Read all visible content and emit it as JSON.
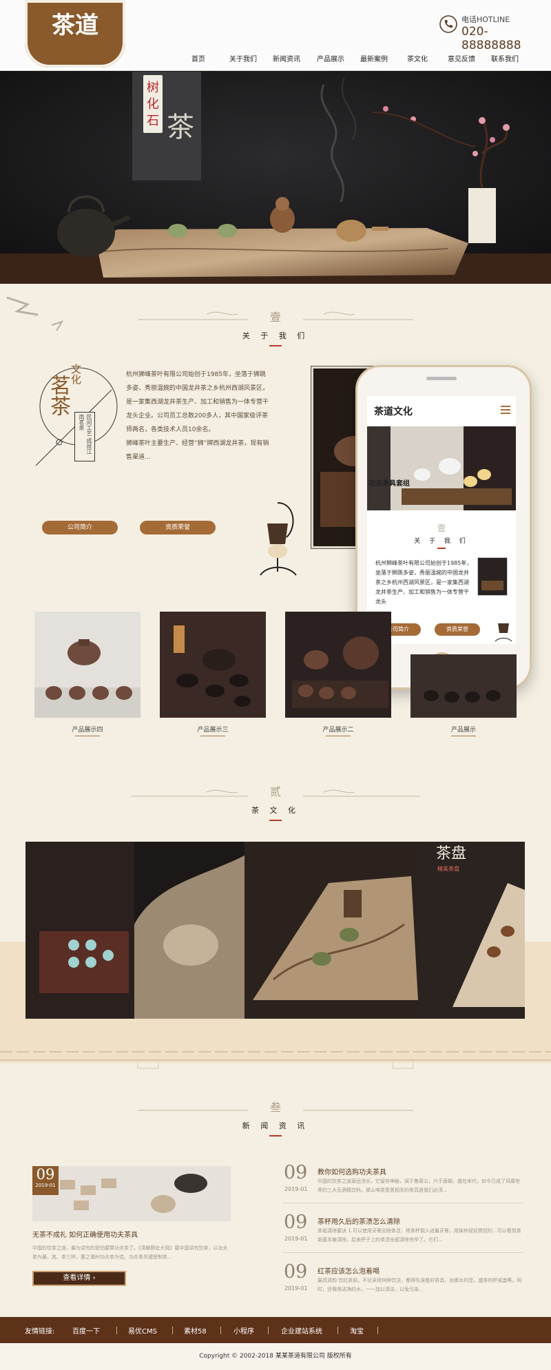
{
  "header": {
    "logo": "茶道",
    "hotline_label": "电话HOTLINE",
    "hotline_number": "020-88888888"
  },
  "nav": [
    "首页",
    "关于我们",
    "新闻资讯",
    "产品展示",
    "最新案例",
    "茶文化",
    "意见反馈",
    "联系我们"
  ],
  "banner": {
    "sign_text": [
      "树",
      "化",
      "石"
    ],
    "calligraphy": "茶"
  },
  "about": {
    "number": "壹",
    "title": "关 于 我 们",
    "badge_small": "文化",
    "badge_large": "茗茶",
    "badge_vertical": [
      "民间工艺",
      "成就江南茗茶"
    ],
    "para1": "杭州狮峰茶叶有限公司始创于1985年，坐落于狮跳多姿、秀丽温婉的中国龙井茶之乡杭州西湖风景区，是一家集西湖龙井茶生产、加工和销售为一体专营干龙头企业。公司员工总数200多人，其中国家级评茶师两名，各类技术人员10余名。",
    "para2": "狮峰茶叶主要生产、经营“狮”牌西湖龙井茶，现有销售渠道...",
    "btn_intro": "公司简介",
    "btn_honor": "资质荣誉"
  },
  "phone": {
    "brand": "茶道文化",
    "hero_text": "功夫茶具套组",
    "number": "壹",
    "title": "关 于 我 们",
    "text": "杭州狮峰茶叶有限公司始创于1985年，坐落于狮跳多姿，秀丽温婉的中国龙井茶之乡杭州西湖风景区，是一家集西湖龙井茶生产、加工和销售为一体专营干龙头",
    "btn_intro": "公司简介",
    "btn_honor": "资质荣誉"
  },
  "products": [
    "产品展示四",
    "产品展示三",
    "产品展示二",
    "产品展示"
  ],
  "culture": {
    "number": "贰",
    "title": "茶 文 化",
    "tea_tray_label": "茶盘",
    "tea_tray_sub": "精美茶盘"
  },
  "news": {
    "number": "叁",
    "title": "新 闻 资 讯",
    "featured": {
      "day": "09",
      "ym": "2019-01",
      "title": "无茶不成礼 如何正确使用功夫茶具",
      "desc": "中国的饮茶之道，最为讲究的恐怕要算功夫茶了。《清朝野史大观》载中国讲究饮茶，以功夫茶为最，其、茶三样，惠之潮州功夫茶为佳。功夫茶关键是制茶...",
      "more": "查看详情"
    },
    "items": [
      {
        "day": "09",
        "ym": "2019-01",
        "title": "教你如何选购功夫茶具",
        "desc": "中国的饮茶之道源远流长，它留存神秘，闻于鲁周公，兴于唐朝，盛在宋代，如今已成了风靡世界的三大无酒精饮料。那么喝茶意思相关的茶具是我们必须..."
      },
      {
        "day": "09",
        "ym": "2019-01",
        "title": "茶杯用久后的茶渍怎么清除",
        "desc": "茶垢清除要诀 1.可以使用牙膏去除茶渍，将茶杯倒入适量牙膏，用抹布轻轻擦拭的...可以看到茶垢基本被清除。后来杯子上的茶渍全部清除完毕了。它们..."
      },
      {
        "day": "09",
        "ym": "2019-01",
        "title": "红茶应该怎么泡着喝",
        "desc": "最具清韵 饮红茶前，不论采用何种饮法，都得先准备好茶具，如煮水的壶，盛茶的杯或盏等。同时，还需用洁净的水，一一加以清洁，以免污染..."
      }
    ]
  },
  "footer": {
    "links_label": "友情链接:",
    "links": [
      "百度一下",
      "易优CMS",
      "素材58",
      "小程序",
      "企业建站系统",
      "淘宝"
    ],
    "copyright": "Copyright © 2002-2018 某某茶道有限公司 版权所有"
  },
  "colors": {
    "brand_brown": "#8a5a2c",
    "button_brown": "#a56b37",
    "footer_brown": "#5e3119",
    "page_bg": "#f4efe2"
  }
}
